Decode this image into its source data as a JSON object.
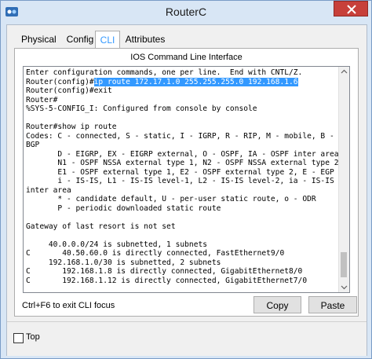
{
  "window": {
    "title": "RouterC"
  },
  "tabs": [
    {
      "label": "Physical"
    },
    {
      "label": "Config"
    },
    {
      "label": "CLI"
    },
    {
      "label": "Attributes"
    }
  ],
  "cli": {
    "panel_title": "IOS Command Line Interface",
    "lines": [
      "Enter configuration commands, one per line.  End with CNTL/Z.",
      "Router(config)#ip route 172.17.1.0 255.255.255.0 192.168.1.6",
      "Router(config)#exit",
      "Router#",
      "%SYS-5-CONFIG_I: Configured from console by console",
      "",
      "Router#show ip route",
      "Codes: C - connected, S - static, I - IGRP, R - RIP, M - mobile, B -",
      "BGP",
      "       D - EIGRP, EX - EIGRP external, O - OSPF, IA - OSPF inter area",
      "       N1 - OSPF NSSA external type 1, N2 - OSPF NSSA external type 2",
      "       E1 - OSPF external type 1, E2 - OSPF external type 2, E - EGP",
      "       i - IS-IS, L1 - IS-IS level-1, L2 - IS-IS level-2, ia - IS-IS",
      "inter area",
      "       * - candidate default, U - per-user static route, o - ODR",
      "       P - periodic downloaded static route",
      "",
      "Gateway of last resort is not set",
      "",
      "     40.0.0.0/24 is subnetted, 1 subnets",
      "C       40.50.60.0 is directly connected, FastEthernet9/0",
      "     192.168.1.0/30 is subnetted, 2 subnets",
      "C       192.168.1.8 is directly connected, GigabitEthernet8/0",
      "C       192.168.1.12 is directly connected, GigabitEthernet7/0"
    ],
    "selected_line": {
      "prefix": "Router(config)#",
      "selected": "ip route 172.17.1.0 255.255.255.0 192.168.1.6"
    }
  },
  "footer": {
    "hint": "Ctrl+F6 to exit CLI focus",
    "copy_label": "Copy",
    "paste_label": "Paste"
  },
  "bottom": {
    "top_label": "Top",
    "top_checked": false
  },
  "colors": {
    "selection": "#3399ff",
    "active_tab": "#3399ff",
    "close_button": "#c7403a"
  }
}
